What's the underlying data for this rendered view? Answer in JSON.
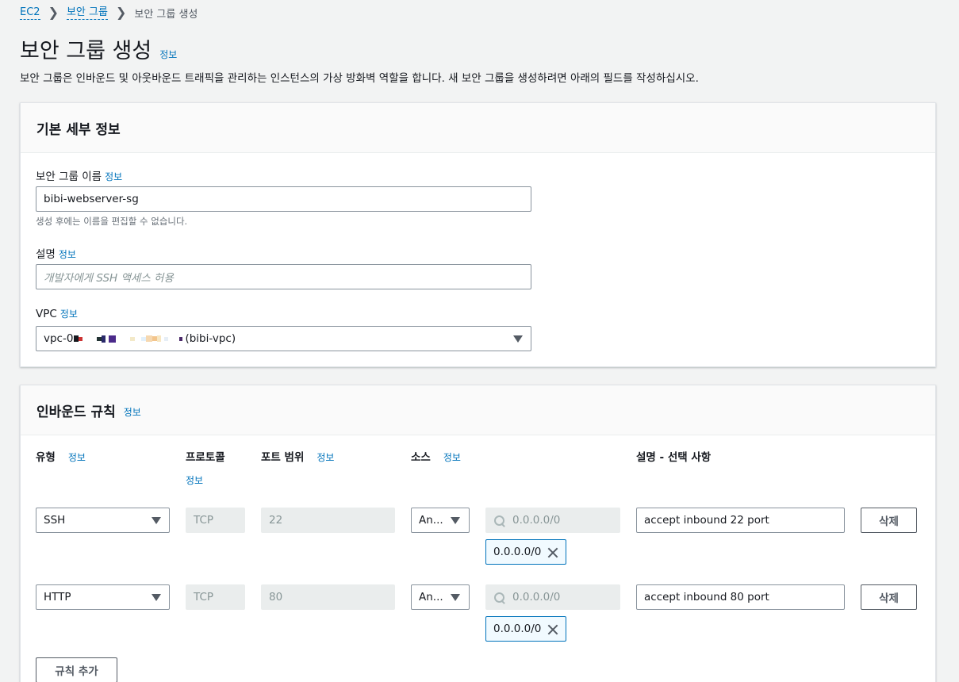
{
  "breadcrumb": {
    "items": [
      "EC2",
      "보안 그룹"
    ],
    "current": "보안 그룹 생성"
  },
  "page": {
    "title": "보안 그룹 생성",
    "title_info": "정보",
    "description": "보안 그룹은 인바운드 및 아웃바운드 트래픽을 관리하는 인스턴스의 가상 방화벽 역할을 합니다. 새 보안 그룹을 생성하려면 아래의 필드를 작성하십시오."
  },
  "basic_details": {
    "header": "기본 세부 정보",
    "name_label": "보안 그룹 이름",
    "name_info": "정보",
    "name_value": "bibi-webserver-sg",
    "name_hint": "생성 후에는 이름을 편집할 수 없습니다.",
    "desc_label": "설명",
    "desc_info": "정보",
    "desc_placeholder": "개발자에게 SSH 액세스 허용",
    "vpc_label": "VPC",
    "vpc_info": "정보",
    "vpc_prefix": "vpc-0",
    "vpc_suffix": "(bibi-vpc)"
  },
  "inbound": {
    "header": "인바운드 규칙",
    "header_info": "정보",
    "columns": {
      "type": "유형",
      "type_info": "정보",
      "protocol": "프로토콜",
      "protocol_info": "정보",
      "port": "포트 범위",
      "port_info": "정보",
      "source": "소스",
      "source_info": "정보",
      "description": "설명 - 선택 사항"
    },
    "rules": [
      {
        "type": "SSH",
        "protocol": "TCP",
        "port": "22",
        "source_type": "An...",
        "cidr_placeholder": "0.0.0.0/0",
        "token": "0.0.0.0/0",
        "description": "accept inbound 22 port",
        "delete_label": "삭제"
      },
      {
        "type": "HTTP",
        "protocol": "TCP",
        "port": "80",
        "source_type": "An...",
        "cidr_placeholder": "0.0.0.0/0",
        "token": "0.0.0.0/0",
        "description": "accept inbound 80 port",
        "delete_label": "삭제"
      }
    ],
    "add_rule_label": "규칙 추가"
  },
  "colors": {
    "link": "#0073bb",
    "background": "#f2f3f3",
    "token_bg": "#f1faff"
  }
}
